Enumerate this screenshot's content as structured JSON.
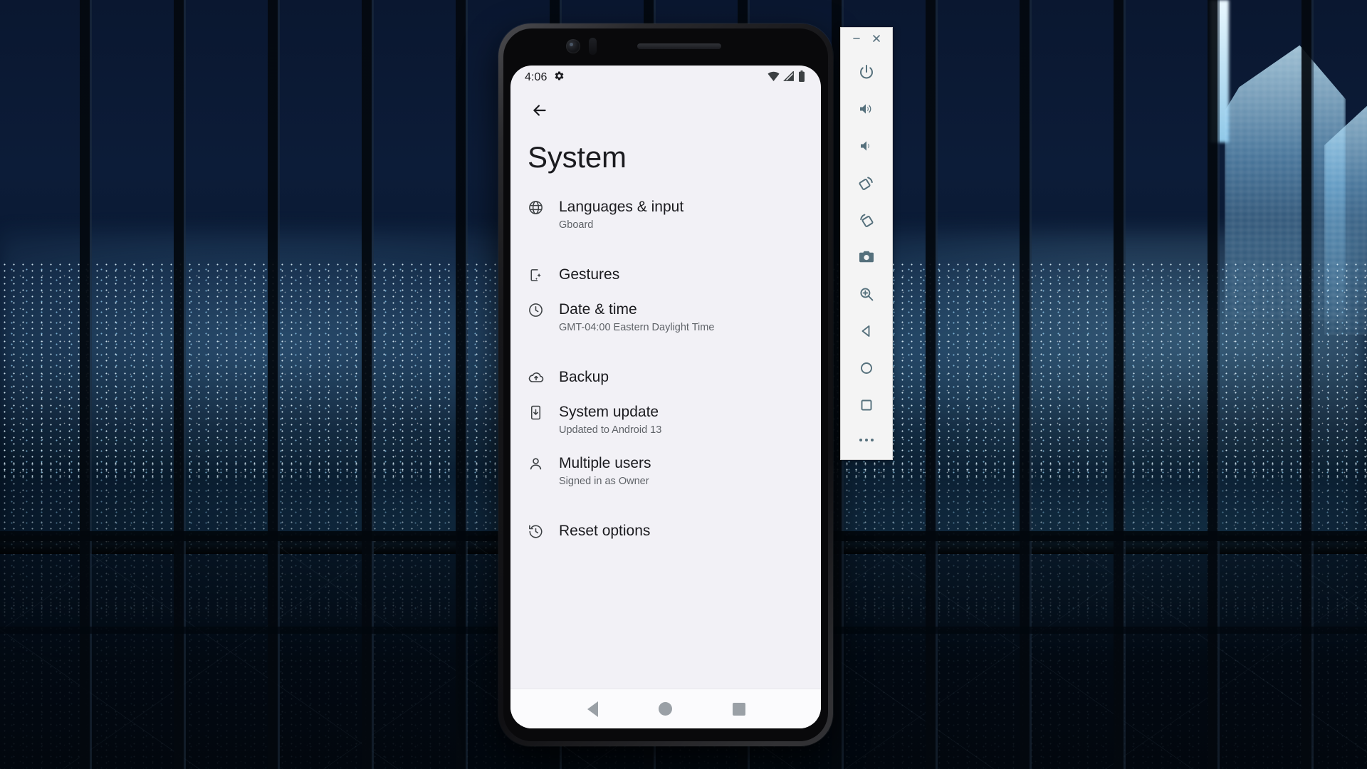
{
  "wallpaper": {
    "description": "night-cityscape-through-windows"
  },
  "phone": {
    "status_bar": {
      "time": "4:06",
      "icons": [
        "settings-gear-icon",
        "wifi-icon",
        "cellular-signal-icon",
        "battery-icon"
      ]
    },
    "back_button": "back-arrow-icon",
    "page_title": "System",
    "settings_items": [
      {
        "icon": "globe-icon",
        "title": "Languages & input",
        "subtitle": "Gboard"
      },
      {
        "icon": "gestures-icon",
        "title": "Gestures",
        "subtitle": ""
      },
      {
        "icon": "clock-icon",
        "title": "Date & time",
        "subtitle": "GMT-04:00 Eastern Daylight Time"
      },
      {
        "icon": "cloud-upload-icon",
        "title": "Backup",
        "subtitle": ""
      },
      {
        "icon": "system-update-icon",
        "title": "System update",
        "subtitle": "Updated to Android 13"
      },
      {
        "icon": "person-icon",
        "title": "Multiple users",
        "subtitle": "Signed in as Owner"
      },
      {
        "icon": "history-icon",
        "title": "Reset options",
        "subtitle": ""
      }
    ],
    "nav_bar": {
      "back": "nav-back-icon",
      "home": "nav-home-icon",
      "recents": "nav-recents-icon"
    }
  },
  "emulator_toolbar": {
    "window_controls": [
      {
        "name": "minimize",
        "glyph": "–"
      },
      {
        "name": "close",
        "glyph": "×"
      }
    ],
    "buttons": [
      {
        "name": "power-button",
        "label": "Power"
      },
      {
        "name": "volume-up-button",
        "label": "Volume Up"
      },
      {
        "name": "volume-down-button",
        "label": "Volume Down"
      },
      {
        "name": "rotate-left-button",
        "label": "Rotate Left"
      },
      {
        "name": "rotate-right-button",
        "label": "Rotate Right"
      },
      {
        "name": "screenshot-button",
        "label": "Take Screenshot"
      },
      {
        "name": "zoom-button",
        "label": "Enter Zoom Mode"
      },
      {
        "name": "back-button",
        "label": "Back"
      },
      {
        "name": "home-button",
        "label": "Home"
      },
      {
        "name": "overview-button",
        "label": "Overview"
      },
      {
        "name": "more-button",
        "label": "More"
      }
    ]
  },
  "colors": {
    "screen_bg": "#f2f1f6",
    "nav_bg": "#fbfbfd",
    "text_primary": "#1b1b1f",
    "text_secondary": "#5f6368",
    "toolbar_bg": "#f4f4f4",
    "toolbar_icon": "#55707c"
  }
}
